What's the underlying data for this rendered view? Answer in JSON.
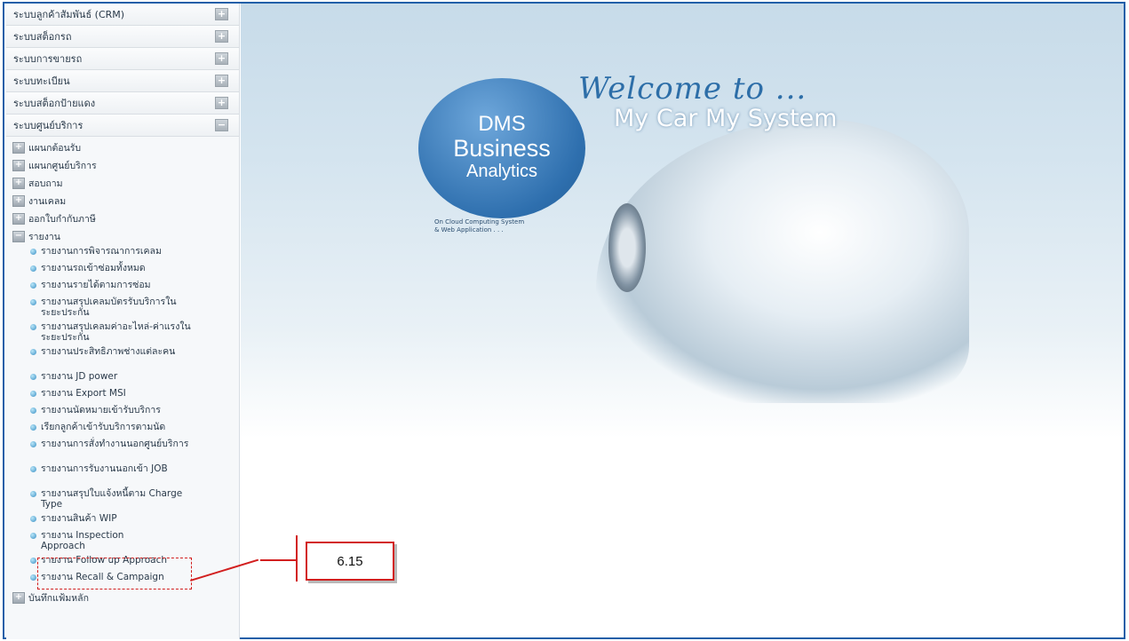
{
  "sidebar": {
    "headers": [
      {
        "label": "ระบบลูกค้าสัมพันธ์ (CRM)",
        "toggle": "+"
      },
      {
        "label": "ระบบสต็อกรถ",
        "toggle": "+"
      },
      {
        "label": "ระบบการขายรถ",
        "toggle": "+"
      },
      {
        "label": "ระบบทะเบียน",
        "toggle": "+"
      },
      {
        "label": "ระบบสต็อกป้ายแดง",
        "toggle": "+"
      },
      {
        "label": "ระบบศูนย์บริการ",
        "toggle": "−"
      }
    ],
    "tree": [
      {
        "label": "แผนกต้อนรับ",
        "toggle": "+"
      },
      {
        "label": "แผนกศูนย์บริการ",
        "toggle": "+"
      },
      {
        "label": "สอบถาม",
        "toggle": "+"
      },
      {
        "label": "งานเคลม",
        "toggle": "+"
      },
      {
        "label": "ออกใบกำกับภาษี",
        "toggle": "+"
      },
      {
        "label": "รายงาน",
        "toggle": "−"
      }
    ],
    "reports": [
      "รายงานการพิจารณาการเคลม",
      "รายงานรถเข้าซ่อมทั้งหมด",
      "รายงานรายได้ตามการซ่อม",
      "รายงานสรุปเคลมบัตรรับบริการในระยะประกัน",
      "รายงานสรุปเคลมค่าอะไหล่-ค่าแรงในระยะประกัน",
      "รายงานประสิทธิภาพช่างแต่ละคน",
      "รายงาน JD power",
      "รายงาน Export MSI",
      "รายงานนัดหมายเข้ารับบริการ",
      "เรียกลูกค้าเข้ารับบริการตามนัด",
      "รายงานการสั่งทำงานนอกศูนย์บริการ",
      "รายงานการรับงานนอกเข้า JOB",
      "รายงานสรุปใบแจ้งหนี้ตาม Charge Type",
      "รายงานสินค้า WIP",
      "รายงาน Inspection Approach",
      "รายงาน Follow up Approach",
      "รายงาน Recall & Campaign"
    ],
    "footer_item": {
      "label": "บันทึกแฟ้มหลัก",
      "toggle": "+"
    }
  },
  "banner": {
    "welcome": "Welcome to ...",
    "tagline": "My Car  My System",
    "logo_line1": "DMS",
    "logo_line2": "Business",
    "logo_line3": "Analytics",
    "caption_line1": "On Cloud Computing System",
    "caption_line2": "& Web Application . . ."
  },
  "callout": {
    "label": "6.15"
  }
}
